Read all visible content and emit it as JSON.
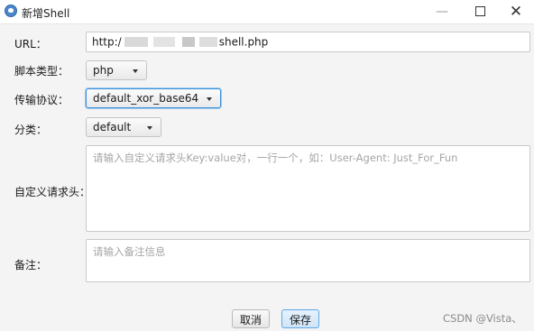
{
  "window": {
    "title": "新增Shell",
    "icon": "shell-app-icon",
    "controls": {
      "minimize": "—",
      "close": "✕"
    }
  },
  "form": {
    "url": {
      "label": "URL：",
      "value_prefix": "http:/",
      "value_suffix": "shell.php"
    },
    "script_type": {
      "label": "脚本类型：",
      "value": "php"
    },
    "protocol": {
      "label": "传输协议：",
      "value": "default_xor_base64"
    },
    "category": {
      "label": "分类：",
      "value": "default"
    },
    "headers": {
      "label": "自定义请求头：",
      "placeholder": "请输入自定义请求头Key:value对，一行一个，如：User-Agent: Just_For_Fun"
    },
    "notes": {
      "label": "备注：",
      "placeholder": "请输入备注信息"
    }
  },
  "buttons": {
    "cancel": "取消",
    "save": "保存"
  },
  "watermark": "CSDN @Vista、",
  "colors": {
    "focus_border": "#3b8fd9",
    "save_border": "#5ea8e6"
  }
}
